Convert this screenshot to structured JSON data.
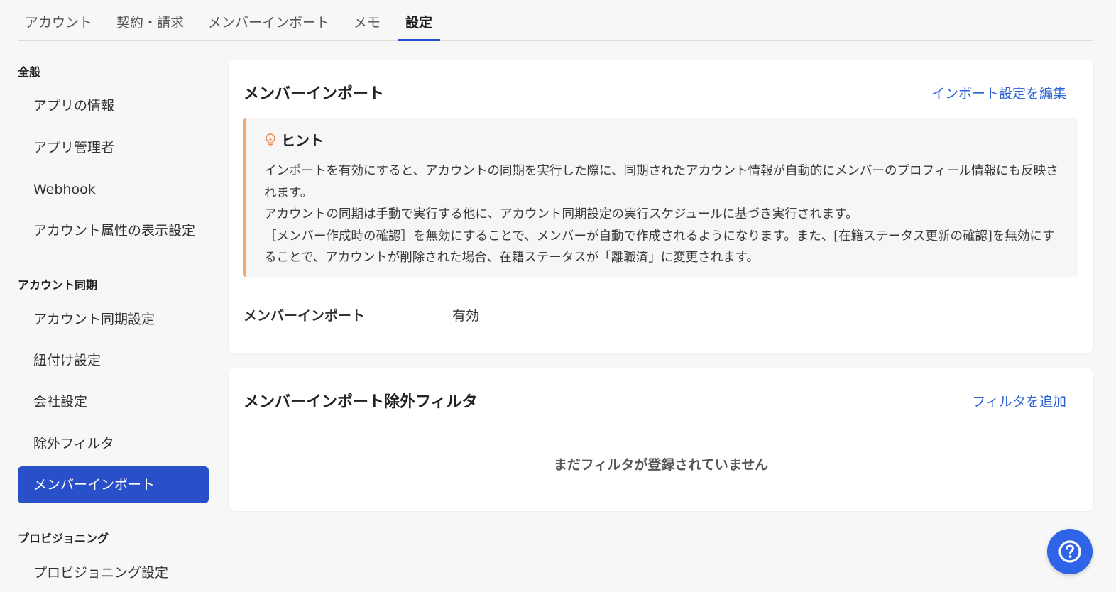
{
  "tabs": [
    {
      "label": "アカウント"
    },
    {
      "label": "契約・請求"
    },
    {
      "label": "メンバーインポート"
    },
    {
      "label": "メモ"
    },
    {
      "label": "設定",
      "active": true
    }
  ],
  "sidebar": {
    "groups": [
      {
        "title": "全般",
        "items": [
          "アプリの情報",
          "アプリ管理者",
          "Webhook",
          "アカウント属性の表示設定"
        ]
      },
      {
        "title": "アカウント同期",
        "items": [
          "アカウント同期設定",
          "紐付け設定",
          "会社設定",
          "除外フィルタ",
          "メンバーインポート"
        ]
      },
      {
        "title": "プロビジョニング",
        "items": [
          "プロビジョニング設定"
        ]
      }
    ],
    "active_item": "メンバーインポート"
  },
  "import_card": {
    "title": "メンバーインポート",
    "edit_link": "インポート設定を編集",
    "hint": {
      "icon": "lightbulb-icon",
      "title": "ヒント",
      "lines": [
        "インポートを有効にすると、アカウントの同期を実行した際に、同期されたアカウント情報が自動的にメンバーのプロフィール情報にも反映されます。",
        "アカウントの同期は手動で実行する他に、アカウント同期設定の実行スケジュールに基づき実行されます。",
        "［メンバー作成時の確認］を無効にすることで、メンバーが自動で作成されるようになります。また、[在籍ステータス更新の確認]を無効にすることで、アカウントが削除された場合、在籍ステータスが「離職済」に変更されます。"
      ]
    },
    "field_label": "メンバーインポート",
    "field_value": "有効"
  },
  "filter_card": {
    "title": "メンバーインポート除外フィルタ",
    "add_link": "フィルタを追加",
    "empty_message": "まだフィルタが登録されていません"
  },
  "help_button": {
    "icon": "question-mark-icon"
  },
  "colors": {
    "accent": "#2950c8",
    "link": "#2a63d6",
    "hint_border": "#f4a76e",
    "help_button": "#2f64e8"
  }
}
